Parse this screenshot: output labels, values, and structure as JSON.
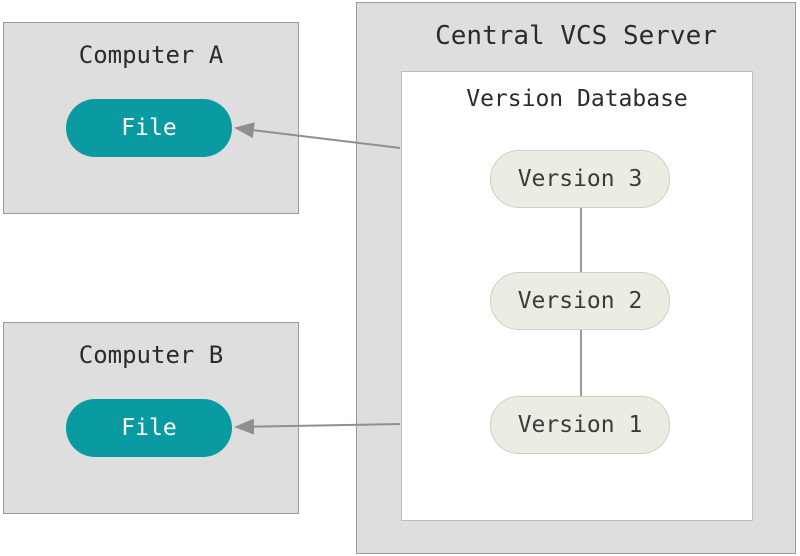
{
  "computers": [
    {
      "title": "Computer A",
      "file_label": "File"
    },
    {
      "title": "Computer B",
      "file_label": "File"
    }
  ],
  "server": {
    "title": "Central VCS Server",
    "db_title": "Version Database",
    "versions": [
      "Version 3",
      "Version 2",
      "Version 1"
    ]
  },
  "colors": {
    "box_bg": "#dfdedf",
    "box_border": "#9a9a9a",
    "pill_teal": "#0a9ba2",
    "pill_gray": "#edece3",
    "arrow": "#8f8f8f"
  }
}
